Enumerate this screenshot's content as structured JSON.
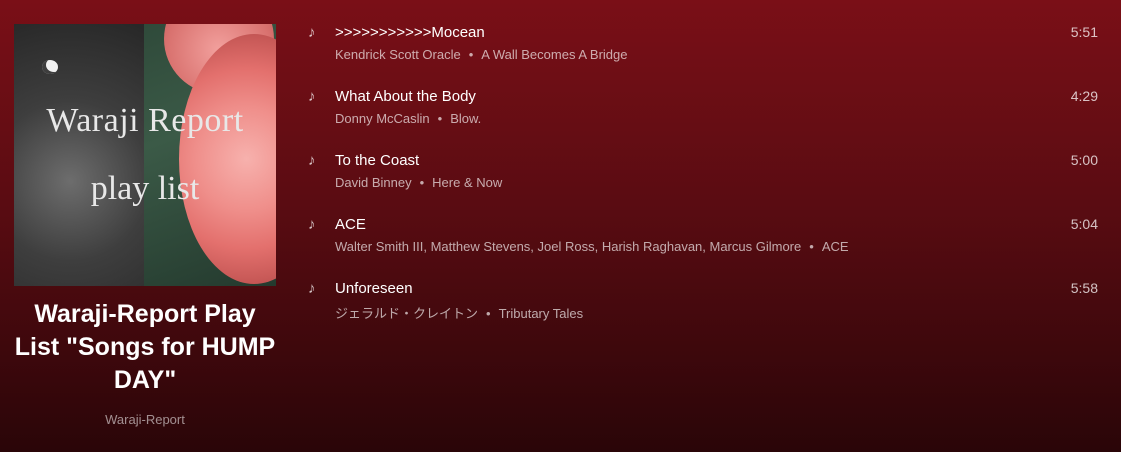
{
  "playlist": {
    "cover": {
      "line1": "Waraji Report",
      "line2": "play list"
    },
    "title": "Waraji-Report Play List \"Songs for HUMP DAY\"",
    "owner": "Waraji-Report"
  },
  "icons": {
    "track": "music-note-icon"
  },
  "tracks": [
    {
      "name": ">>>>>>>>>>>Mocean",
      "artists": "Kendrick Scott Oracle",
      "album": "A Wall Becomes A Bridge",
      "duration": "5:51"
    },
    {
      "name": "What About the Body",
      "artists": "Donny McCaslin",
      "album": "Blow.",
      "duration": "4:29"
    },
    {
      "name": "To the Coast",
      "artists": "David Binney",
      "album": "Here & Now",
      "duration": "5:00"
    },
    {
      "name": "ACE",
      "artists": "Walter Smith III, Matthew Stevens, Joel Ross, Harish Raghavan, Marcus Gilmore",
      "album": "ACE",
      "duration": "5:04"
    },
    {
      "name": "Unforeseen",
      "artists": "ジェラルド・クレイトン",
      "album": "Tributary Tales",
      "duration": "5:58"
    }
  ],
  "separator": "•"
}
